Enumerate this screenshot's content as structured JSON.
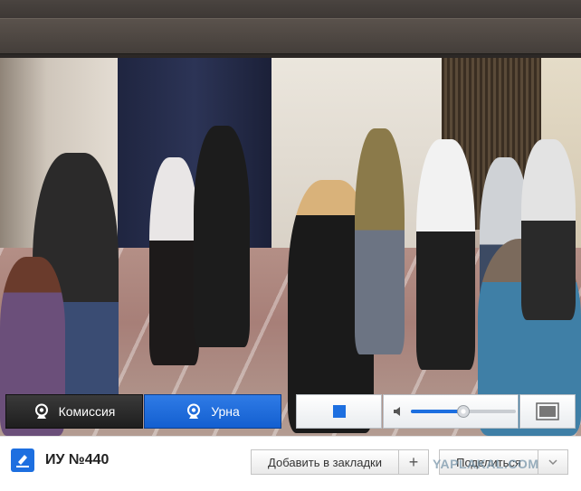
{
  "video": {
    "camera_buttons": [
      {
        "label": "Комиссия",
        "icon": "webcam-icon",
        "active": false
      },
      {
        "label": "Урна",
        "icon": "webcam-icon",
        "active": true
      }
    ],
    "stop_icon": "stop-icon",
    "volume": {
      "icon": "speaker-icon",
      "level": 0.5
    },
    "fullscreen_icon": "fullscreen-icon"
  },
  "bottom_bar": {
    "logo_icon": "ballot-box-icon",
    "title": "ИУ №440",
    "bookmark_label": "Добавить в закладки",
    "plus_label": "+",
    "share_label": "Поделиться",
    "watermark": "YAPLAKAL.COM"
  },
  "colors": {
    "accent": "#1d6fe0",
    "active_camera": "#135fd0",
    "inactive_camera": "#1e1e1e"
  }
}
